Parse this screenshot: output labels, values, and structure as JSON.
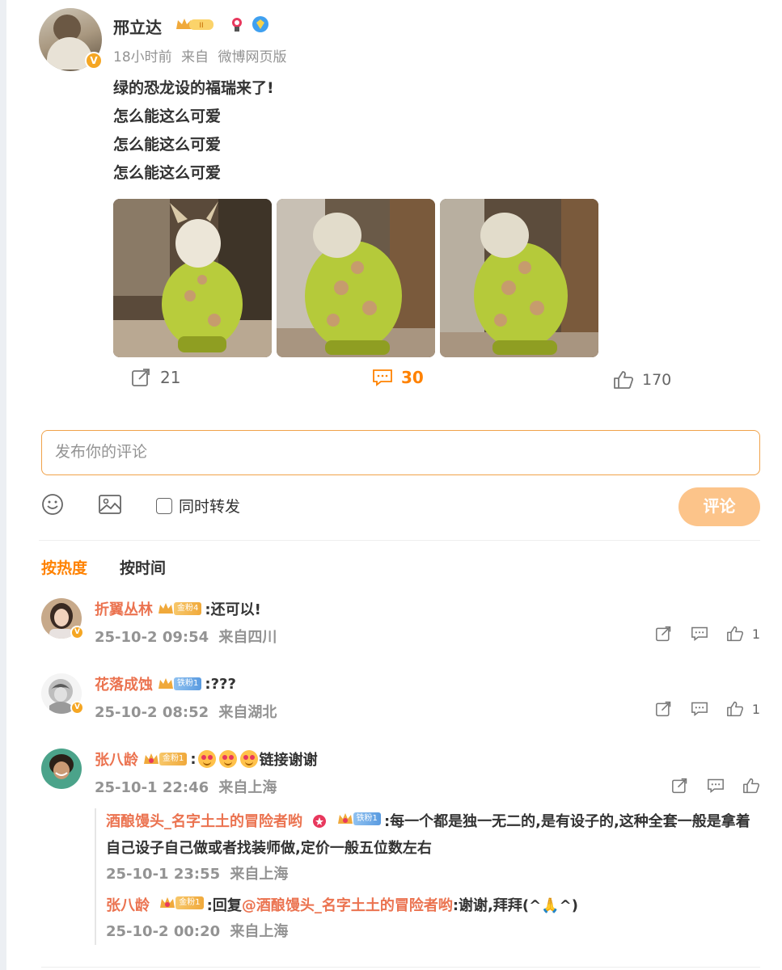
{
  "post": {
    "author": "邢立达",
    "level_badge": "II",
    "time": "18小时前",
    "source_prefix": "来自",
    "source": "微博网页版",
    "lines": [
      "绿的恐龙设的福瑞来了!",
      "怎么能这么可爱",
      "怎么能这么可爱",
      "怎么能这么可爱"
    ],
    "image_count": 3,
    "stats": {
      "reposts": "21",
      "comments": "30",
      "likes": "170"
    }
  },
  "composer": {
    "placeholder": "发布你的评论",
    "repost_label": "同时转发",
    "submit_label": "评论"
  },
  "sort": {
    "hot": "按热度",
    "time": "按时间"
  },
  "comments": [
    {
      "name": "折翼丛林",
      "fan_badge": "金粉4",
      "text": ":还可以!",
      "date": "25-10-2 09:54",
      "location": "来自四川",
      "likes": "1"
    },
    {
      "name": "花落成蚀",
      "fan_badge": "铁粉1",
      "text": ":???",
      "date": "25-10-2 08:52",
      "location": "来自湖北",
      "likes": "1"
    },
    {
      "name": "张八龄",
      "fan_badge": "金粉1",
      "text_prefix": ":",
      "text": "链接谢谢",
      "date": "25-10-1 22:46",
      "location": "来自上海",
      "likes": ""
    }
  ],
  "replies": [
    {
      "name": "酒酿馒头_名字土土的冒险者哟",
      "fan_badge": "铁粉1",
      "text": ":每一个都是独一无二的,是有设子的,这种全套一般是拿着自己设子自己做或者找装师做,定价一般五位数左右",
      "date": "25-10-1 23:55",
      "location": "来自上海"
    },
    {
      "name": "张八龄",
      "fan_badge": "金粉1",
      "text_prefix": ":回复",
      "mention": "@酒酿馒头_名字土土的冒险者哟",
      "text": ":谢谢,拜拜(^🙏^)",
      "date": "25-10-2 00:20",
      "location": "来自上海"
    }
  ]
}
